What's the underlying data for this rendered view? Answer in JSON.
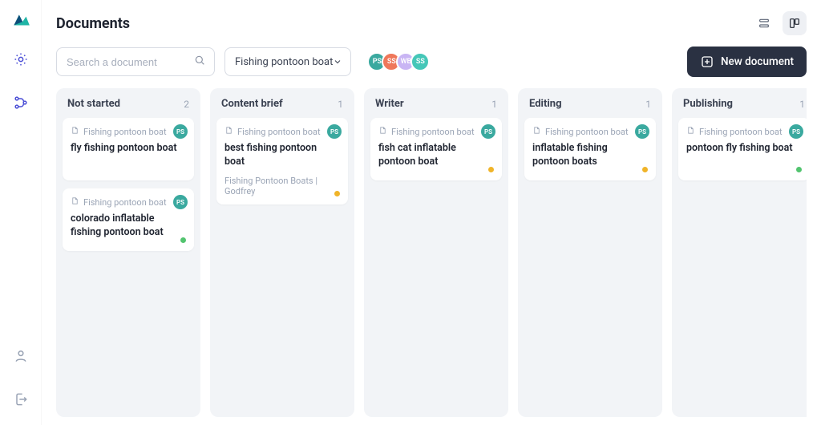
{
  "page": {
    "title": "Documents"
  },
  "search": {
    "placeholder": "Search a document"
  },
  "filter": {
    "selected": "Fishing pontoon boat"
  },
  "avatars": [
    {
      "initials": "PS",
      "color": "#3aa99f"
    },
    {
      "initials": "SS",
      "color": "#ef775a"
    },
    {
      "initials": "WB",
      "color": "#c9b5f4"
    },
    {
      "initials": "SS",
      "color": "#45c7b8"
    }
  ],
  "newDocLabel": "New document",
  "columns": [
    {
      "title": "Not started",
      "count": "2",
      "cards": [
        {
          "folder": "Fishing pontoon boat",
          "title": "fly fishing pontoon boat",
          "avatar": {
            "initials": "PS",
            "color": "#3aa99f"
          }
        },
        {
          "folder": "Fishing pontoon boat",
          "title": "colorado inflatable fishing pontoon boat",
          "avatar": {
            "initials": "PS",
            "color": "#3aa99f"
          },
          "status": "#52c46f"
        }
      ]
    },
    {
      "title": "Content brief",
      "count": "1",
      "cards": [
        {
          "folder": "Fishing pontoon boat",
          "title": "best fishing pontoon boat",
          "subtitle": "Fishing Pontoon Boats | Godfrey",
          "avatar": {
            "initials": "PS",
            "color": "#3aa99f"
          },
          "status": "#f0b429"
        }
      ]
    },
    {
      "title": "Writer",
      "count": "1",
      "cards": [
        {
          "folder": "Fishing pontoon boat",
          "title": "fish cat inflatable pontoon boat",
          "avatar": {
            "initials": "PS",
            "color": "#3aa99f"
          },
          "status": "#f0b429"
        }
      ]
    },
    {
      "title": "Editing",
      "count": "1",
      "cards": [
        {
          "folder": "Fishing pontoon boat",
          "title": "inflatable fishing pontoon boats",
          "avatar": {
            "initials": "PS",
            "color": "#3aa99f"
          },
          "status": "#f0b429"
        }
      ]
    },
    {
      "title": "Publishing",
      "count": "1",
      "cards": [
        {
          "folder": "Fishing pontoon boat",
          "title": "pontoon fly fishing boat",
          "avatar": {
            "initials": "PS",
            "color": "#3aa99f"
          },
          "status": "#52c46f"
        }
      ]
    }
  ]
}
